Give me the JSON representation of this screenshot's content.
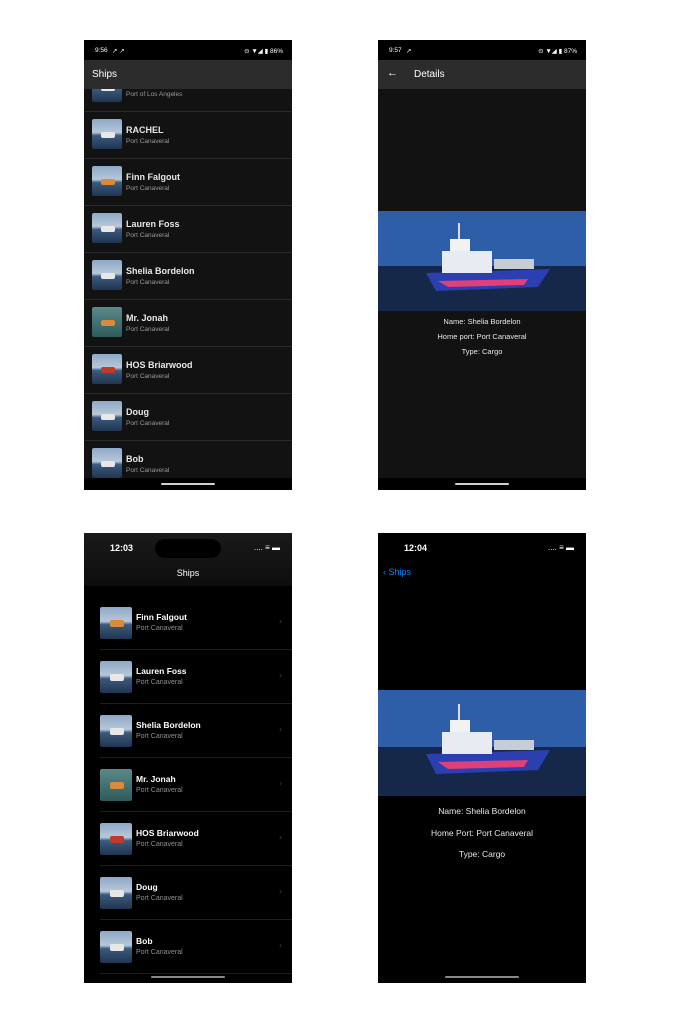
{
  "android_list": {
    "status": {
      "time": "9:56",
      "notif": "↗ ↗",
      "right": "⊝ ▼◢ ▮ 86%"
    },
    "title": "Ships",
    "partial_port": "Port of Los Angeles",
    "items": [
      {
        "name": "RACHEL",
        "port": "Port Canaveral"
      },
      {
        "name": "Finn Falgout",
        "port": "Port Canaveral"
      },
      {
        "name": "Lauren Foss",
        "port": "Port Canaveral"
      },
      {
        "name": "Shelia Bordelon",
        "port": "Port Canaveral"
      },
      {
        "name": "Mr. Jonah",
        "port": "Port Canaveral"
      },
      {
        "name": "HOS Briarwood",
        "port": "Port Canaveral"
      },
      {
        "name": "Doug",
        "port": "Port Canaveral"
      },
      {
        "name": "Bob",
        "port": "Port Canaveral"
      }
    ]
  },
  "android_detail": {
    "status": {
      "time": "9:57",
      "notif": "↗",
      "right": "⊝ ▼◢ ▮ 87%"
    },
    "back_icon": "arrow-left-icon",
    "title": "Details",
    "name_line": "Name: Shelia Bordelon",
    "port_line": "Home port: Port Canaveral",
    "type_line": "Type: Cargo"
  },
  "ios_list": {
    "time": "12:03",
    "icons": "....  ≡ ▬",
    "title": "Ships",
    "items": [
      {
        "name": "Finn Falgout",
        "port": "Port Canaveral"
      },
      {
        "name": "Lauren Foss",
        "port": "Port Canaveral"
      },
      {
        "name": "Shelia Bordelon",
        "port": "Port Canaveral"
      },
      {
        "name": "Mr. Jonah",
        "port": "Port Canaveral"
      },
      {
        "name": "HOS Briarwood",
        "port": "Port Canaveral"
      },
      {
        "name": "Doug",
        "port": "Port Canaveral"
      },
      {
        "name": "Bob",
        "port": "Port Canaveral"
      }
    ]
  },
  "ios_detail": {
    "time": "12:04",
    "icons": "....  ≡ ▬",
    "back_label": "Ships",
    "name_line": "Name: Shelia Bordelon",
    "port_line": "Home Port: Port Canaveral",
    "type_line": "Type: Cargo"
  }
}
